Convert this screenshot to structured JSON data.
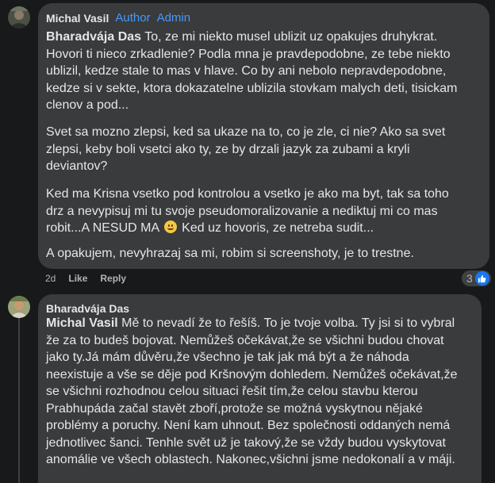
{
  "comments": [
    {
      "author": "Michal Vasil",
      "badges": [
        "Author",
        "Admin"
      ],
      "mention": "Bharadvája Das",
      "paragraphs": [
        [
          "To, ze mi niekto musel ublizit uz opakujes druhykrat.",
          "Hovori ti nieco zrkadlenie? Podla mna je pravdepodobne, ze tebe niekto",
          "ublizil, kedze stale to mas v hlave. Co by ani nebolo nepravdepodobne,",
          "kedze si v sekte, ktora dokazatelne ublizila stovkam malych deti, tisickam",
          "clenov a pod..."
        ],
        [
          "Svet sa mozno zlepsi, ked sa ukaze na to, co je zle, ci nie? Ako sa svet",
          "zlepsi, keby boli vsetci ako ty, ze by drzali jazyk za zubami a kryli",
          "deviantov?"
        ],
        [
          "Ked ma Krisna vsetko pod kontrolou a vsetko je ako ma byt, tak sa toho",
          "drz a nevypisuj mi tu svoje pseudomoralizovanie a nediktuj mi co mas",
          "robit...A NESUD MA",
          "Ked uz hovoris, ze netreba sudit..."
        ],
        [
          "A opakujem, nevyhrazaj sa mi, robim si screenshoty, je to trestne."
        ]
      ],
      "emoji": "grinning-face-emoji",
      "time": "2d",
      "like_label": "Like",
      "reply_label": "Reply",
      "reaction_count": "3"
    },
    {
      "author": "Bharadvája Das",
      "mention": "Michal Vasil",
      "lines": [
        "Mě to nevadí že to řešíš. To je tvoje volba. Ty jsi si to vybral",
        "že za to budeš bojovat. Nemůžeš očekávat,že se všichni budou chovat",
        "jako ty.Já mám důvěru,že všechno je tak jak má být a že náhoda",
        "neexistuje a vše se děje pod Kršnovým dohledem. Nemůžeš očekávat,že",
        "se všichni rozhodnou celou situaci řešit tím,že celou stavbu kterou",
        "Prabhupáda začal stavět zboří,protože se možná vyskytnou nějaké",
        "problémy a poruchy. Není kam uhnout. Bez společnosti oddaných nemá",
        "jednotlivec šanci. Tenhle svět už je takový,že se vždy budou vyskytovat",
        "anomálie ve všech oblastech. Nakonec,všichni jsme nedokonalí a v máji."
      ]
    }
  ],
  "colors": {
    "background": "#18191a",
    "bubble": "#3a3b3c",
    "badge": "#4599ff",
    "like_blue": "#1877f2"
  }
}
